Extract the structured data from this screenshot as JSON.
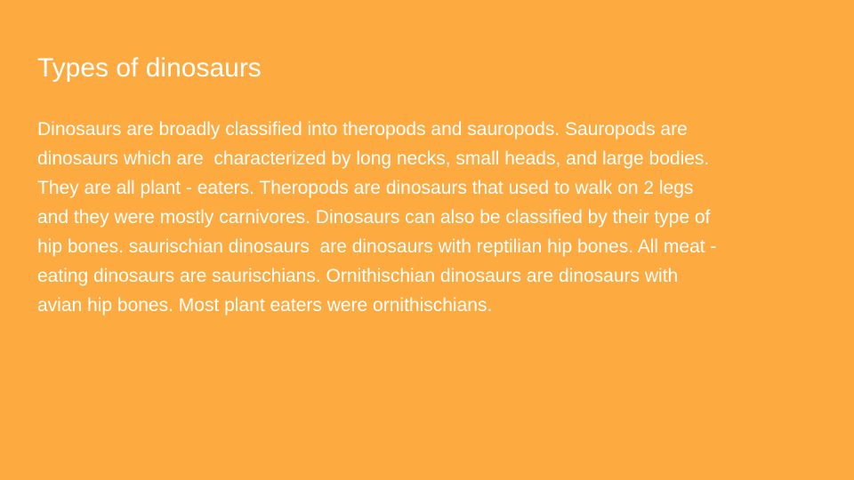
{
  "slide": {
    "title": "Types of dinosaurs",
    "body_lines": [
      "Dinosaurs are broadly classified into theropods and sauropods. Sauropods are",
      "dinosaurs which are  characterized by long necks, small heads, and large bodies.",
      "They are all plant - eaters. Theropods are dinosaurs that used to walk on 2 legs",
      "and they were mostly carnivores. Dinosaurs can also be classified by their type of",
      "hip bones. saurischian dinosaurs  are dinosaurs with reptilian hip bones. All meat -",
      "eating dinosaurs are saurischians. Ornithischian dinosaurs are dinosaurs with",
      "avian hip bones. Most plant eaters were ornithischians."
    ]
  },
  "colors": {
    "background": "#FDAB40",
    "text": "#FFFFFF"
  }
}
